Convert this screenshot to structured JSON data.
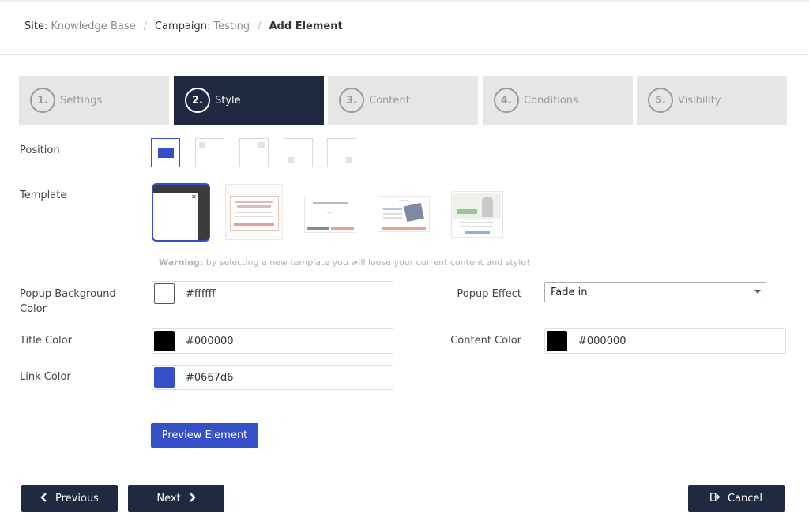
{
  "breadcrumb": {
    "site_key": "Site:",
    "site_value": "Knowledge Base",
    "campaign_key": "Campaign:",
    "campaign_value": "Testing",
    "current": "Add Element"
  },
  "steps": [
    {
      "num": "1.",
      "label": "Settings",
      "active": false
    },
    {
      "num": "2.",
      "label": "Style",
      "active": true
    },
    {
      "num": "3.",
      "label": "Content",
      "active": false
    },
    {
      "num": "4.",
      "label": "Conditions",
      "active": false
    },
    {
      "num": "5.",
      "label": "Visibility",
      "active": false
    }
  ],
  "position": {
    "label": "Position",
    "options": [
      "center",
      "top-left",
      "top-right",
      "bottom-left",
      "bottom-right"
    ],
    "selected": "center"
  },
  "template": {
    "label": "Template",
    "selected_index": 0,
    "warning_bold": "Warning:",
    "warning_text": " by selecting a new template you will loose your current content and style!"
  },
  "fields": {
    "popup_bg": {
      "label": "Popup Background Color",
      "value": "#ffffff",
      "color": "#ffffff"
    },
    "title_color": {
      "label": "Title Color",
      "value": "#000000",
      "color": "#000000"
    },
    "link_color": {
      "label": "Link Color",
      "value": "#0667d6",
      "color": "#3550c8"
    },
    "popup_effect": {
      "label": "Popup Effect",
      "value": "Fade in"
    },
    "content_color": {
      "label": "Content Color",
      "value": "#000000",
      "color": "#000000"
    }
  },
  "buttons": {
    "preview": "Preview Element",
    "previous": "Previous",
    "next": "Next",
    "cancel": "Cancel"
  },
  "colors": {
    "accent": "#3550c8",
    "navy": "#1f2940",
    "step_inactive": "#e6e6e6"
  }
}
